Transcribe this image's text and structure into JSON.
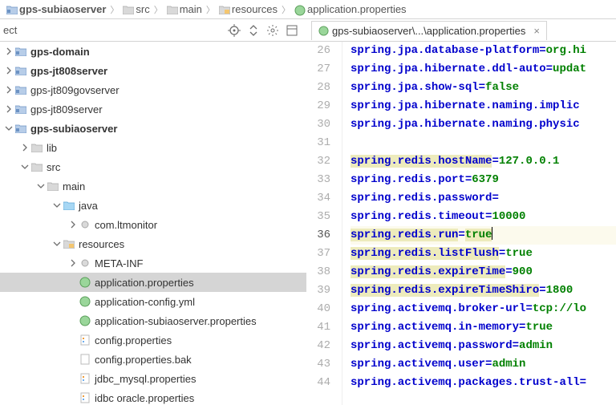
{
  "breadcrumb": [
    {
      "icon": "module",
      "label": "gps-subiaoserver",
      "bold": true
    },
    {
      "icon": "folder",
      "label": "src"
    },
    {
      "icon": "folder",
      "label": "main"
    },
    {
      "icon": "folder-res",
      "label": "resources"
    },
    {
      "icon": "prop",
      "label": "application.properties"
    }
  ],
  "sidebar_truncated": "ect",
  "tab": {
    "label": "gps-subiaoserver\\...\\application.properties"
  },
  "tree": [
    {
      "depth": 0,
      "arrow": "right",
      "icon": "module",
      "label": "gps-domain",
      "bold": true
    },
    {
      "depth": 0,
      "arrow": "right",
      "icon": "module",
      "label": "gps-jt808server",
      "bold": true
    },
    {
      "depth": 0,
      "arrow": "right",
      "icon": "module",
      "label": "gps-jt809govserver"
    },
    {
      "depth": 0,
      "arrow": "right",
      "icon": "module",
      "label": "gps-jt809server"
    },
    {
      "depth": 0,
      "arrow": "down",
      "icon": "module",
      "label": "gps-subiaoserver",
      "bold": true
    },
    {
      "depth": 1,
      "arrow": "right",
      "icon": "folder-g",
      "label": "lib"
    },
    {
      "depth": 1,
      "arrow": "down",
      "icon": "folder",
      "label": "src"
    },
    {
      "depth": 2,
      "arrow": "down",
      "icon": "folder",
      "label": "main"
    },
    {
      "depth": 3,
      "arrow": "down",
      "icon": "folder-src",
      "label": "java"
    },
    {
      "depth": 4,
      "arrow": "right",
      "icon": "package",
      "label": "com.ltmonitor"
    },
    {
      "depth": 3,
      "arrow": "down",
      "icon": "folder-res",
      "label": "resources"
    },
    {
      "depth": 4,
      "arrow": "right",
      "icon": "package",
      "label": "META-INF"
    },
    {
      "depth": 4,
      "arrow": "",
      "icon": "prop",
      "label": "application.properties",
      "selected": true
    },
    {
      "depth": 4,
      "arrow": "",
      "icon": "prop",
      "label": "application-config.yml"
    },
    {
      "depth": 4,
      "arrow": "",
      "icon": "prop",
      "label": "application-subiaoserver.properties"
    },
    {
      "depth": 4,
      "arrow": "",
      "icon": "cfg",
      "label": "config.properties"
    },
    {
      "depth": 4,
      "arrow": "",
      "icon": "file",
      "label": "config.properties.bak"
    },
    {
      "depth": 4,
      "arrow": "",
      "icon": "cfg",
      "label": "jdbc_mysql.properties"
    },
    {
      "depth": 4,
      "arrow": "",
      "icon": "cfg",
      "label": "idbc oracle.properties"
    }
  ],
  "code": {
    "start": 26,
    "current": 36,
    "lines": [
      {
        "n": 26,
        "key": "spring.jpa.database-platform",
        "val": "org.hi",
        "cut": true
      },
      {
        "n": 27,
        "key": "spring.jpa.hibernate.ddl-auto",
        "val": "updat",
        "cut": true
      },
      {
        "n": 28,
        "key": "spring.jpa.show-sql",
        "val": "false"
      },
      {
        "n": 29,
        "key": "spring.jpa.hibernate.naming.implic",
        "nokv": true,
        "cut": true
      },
      {
        "n": 30,
        "key": "spring.jpa.hibernate.naming.physic",
        "nokv": true,
        "cut": true
      },
      {
        "n": 31,
        "blank": true
      },
      {
        "n": 32,
        "key": "spring.redis.hostName",
        "val": "127.0.0.1",
        "hlkey": true
      },
      {
        "n": 33,
        "key": "spring.redis.port",
        "val": "6379"
      },
      {
        "n": 34,
        "key": "spring.redis.password",
        "val": ""
      },
      {
        "n": 35,
        "key": "spring.redis.timeout",
        "val": "10000"
      },
      {
        "n": 36,
        "key": "spring.redis.run",
        "val": "true",
        "hlkey": true,
        "hlval": true,
        "cursor": true
      },
      {
        "n": 37,
        "key": "spring.redis.listFlush",
        "val": "true",
        "hlkey": true
      },
      {
        "n": 38,
        "key": "spring.redis.expireTime",
        "val": "900",
        "hlkey": true
      },
      {
        "n": 39,
        "key": "spring.redis.expireTimeShiro",
        "val": "1800",
        "hlkey": true
      },
      {
        "n": 40,
        "key": "spring.activemq.broker-url",
        "val": "tcp://lo",
        "cut": true
      },
      {
        "n": 41,
        "key": "spring.activemq.in-memory",
        "val": "true"
      },
      {
        "n": 42,
        "key": "spring.activemq.password",
        "val": "admin"
      },
      {
        "n": 43,
        "key": "spring.activemq.user",
        "val": "admin"
      },
      {
        "n": 44,
        "key": "spring.activemq.packages.trust-all",
        "val": "",
        "cut": true
      }
    ]
  }
}
